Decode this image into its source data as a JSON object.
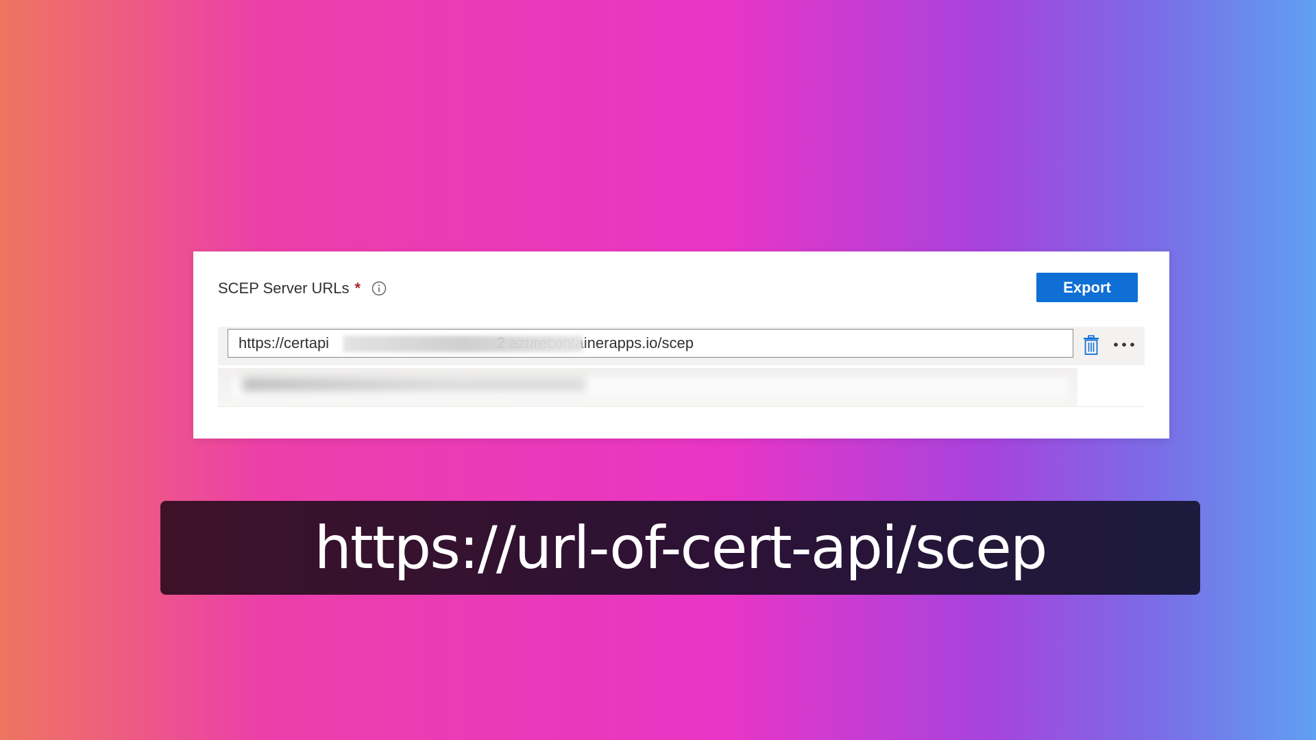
{
  "card": {
    "field_label": "SCEP Server URLs",
    "required_marker": "*",
    "export_label": "Export",
    "url_value": "https://certapi                                        2.azurecontainerapps.io/scep",
    "icons": {
      "info": "info-icon",
      "delete": "trash-icon",
      "more": "more-options-icon"
    }
  },
  "caption": {
    "text": "https://url-of-cert-api/scep"
  },
  "colors": {
    "accent": "#0f6fd4",
    "required": "#a4262c",
    "caption_background": "#2c1236"
  }
}
